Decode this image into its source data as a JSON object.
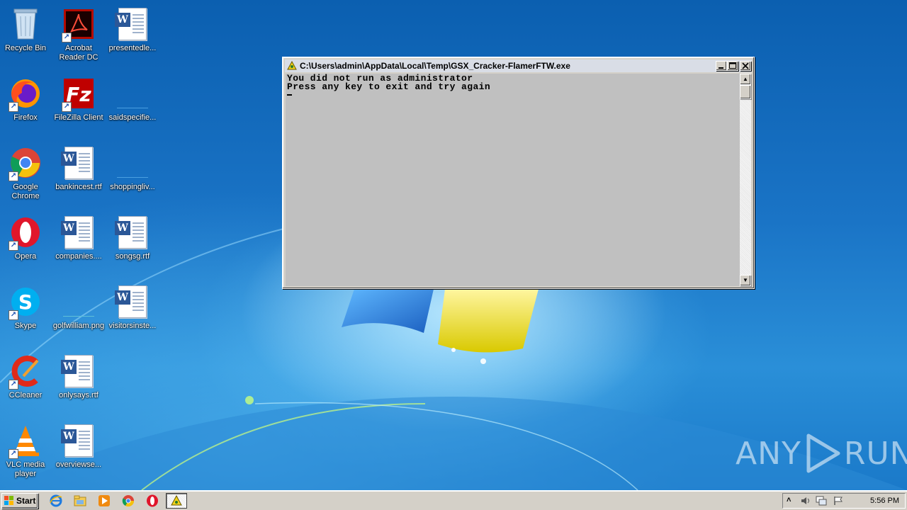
{
  "desktop": {
    "icons": [
      {
        "label": "Recycle Bin"
      },
      {
        "label": "Acrobat Reader DC"
      },
      {
        "label": "presentedle..."
      },
      {
        "label": "Firefox"
      },
      {
        "label": "FileZilla Client"
      },
      {
        "label": "saidspecifie..."
      },
      {
        "label": "Google Chrome"
      },
      {
        "label": "bankincest.rtf"
      },
      {
        "label": "shoppingliv..."
      },
      {
        "label": "Opera"
      },
      {
        "label": "companies...."
      },
      {
        "label": "songsg.rtf"
      },
      {
        "label": "Skype"
      },
      {
        "label": "golfwilliam.png"
      },
      {
        "label": "visitorsinste..."
      },
      {
        "label": "CCleaner"
      },
      {
        "label": "onlysays.rtf"
      },
      {
        "label": "VLC media player"
      },
      {
        "label": "overviewse..."
      }
    ]
  },
  "console": {
    "title": "C:\\Users\\admin\\AppData\\Local\\Temp\\GSX_Cracker-FlamerFTW.exe",
    "lines": [
      "You did not run as administrator",
      "Press any key to exit and try again"
    ]
  },
  "taskbar": {
    "start_label": "Start",
    "clock": "5:56 PM"
  },
  "watermark": {
    "left": "ANY",
    "right": "RUN"
  }
}
